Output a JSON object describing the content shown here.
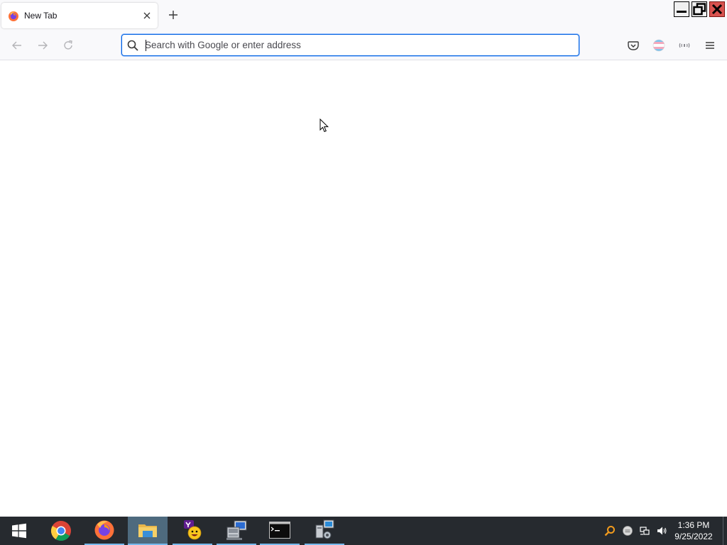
{
  "browser": {
    "tabs": [
      {
        "title": "New Tab",
        "favicon": "firefox-icon",
        "active": true
      }
    ],
    "new_tab_icon": "plus-icon",
    "urlbar": {
      "value": "",
      "placeholder": "Search with Google or enter address"
    },
    "toolbar_icons": [
      "pocket-icon",
      "account-icon",
      "extension-icon",
      "menu-icon"
    ],
    "nav_icons": [
      "back-arrow-icon",
      "forward-arrow-icon",
      "reload-icon"
    ]
  },
  "window_controls": [
    "minimize-icon",
    "restore-icon",
    "close-icon"
  ],
  "taskbar": {
    "apps": [
      {
        "name": "chrome",
        "running": false
      },
      {
        "name": "firefox",
        "running": true
      },
      {
        "name": "file-explorer",
        "running": true,
        "active": true
      },
      {
        "name": "yahoo-messenger",
        "running": true
      },
      {
        "name": "network-computer",
        "running": true
      },
      {
        "name": "command-prompt",
        "running": true
      },
      {
        "name": "network-setup",
        "running": true
      }
    ],
    "clock": {
      "time": "1:36 PM",
      "date": "9/25/2022"
    }
  },
  "colors": {
    "accent": "#0061e0",
    "taskbar": "#262a2f",
    "active_task": "#4e6a7e",
    "close_button": "#d8534f"
  }
}
